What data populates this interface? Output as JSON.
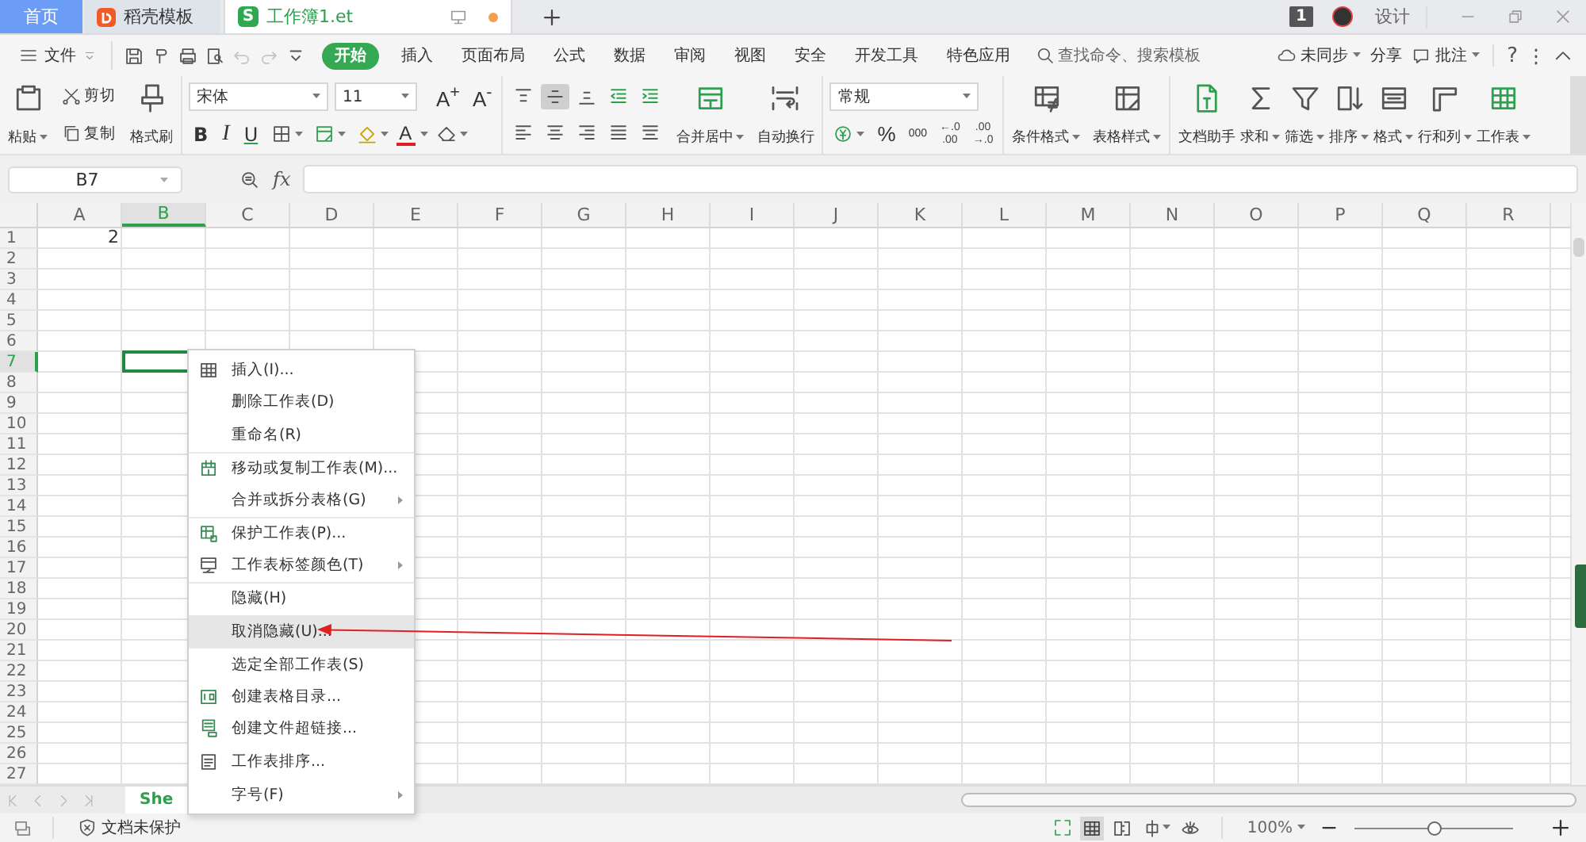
{
  "tabs": [
    {
      "label": "首页",
      "kind": "home",
      "selected": false
    },
    {
      "label": "稻壳模板",
      "kind": "docer",
      "selected": false
    },
    {
      "label": "工作簿1.et",
      "kind": "sheet",
      "logo": "S",
      "selected": true
    }
  ],
  "title_bar": {
    "badge": "1",
    "design": "设计"
  },
  "menu": {
    "file": "文件",
    "quick_tools": [
      {
        "kind": "save",
        "disabled": false
      },
      {
        "kind": "painter",
        "disabled": false
      },
      {
        "kind": "print",
        "disabled": false
      },
      {
        "kind": "preview",
        "disabled": false
      },
      {
        "kind": "undo",
        "disabled": true
      },
      {
        "kind": "redo",
        "disabled": true
      },
      {
        "kind": "more",
        "disabled": false
      }
    ],
    "items": [
      {
        "label": "开始",
        "selected": true
      },
      {
        "label": "插入",
        "selected": false
      },
      {
        "label": "页面布局",
        "selected": false
      },
      {
        "label": "公式",
        "selected": false
      },
      {
        "label": "数据",
        "selected": false
      },
      {
        "label": "审阅",
        "selected": false
      },
      {
        "label": "视图",
        "selected": false
      },
      {
        "label": "安全",
        "selected": false
      },
      {
        "label": "开发工具",
        "selected": false
      },
      {
        "label": "特色应用",
        "selected": false
      }
    ],
    "search": {
      "placeholder": "查找命令、搜索模板"
    },
    "sync": "未同步",
    "share": "分享",
    "comment": "批注",
    "help": "?"
  },
  "ribbon": {
    "clipboard": {
      "paste": "粘贴",
      "cut": "剪切",
      "copy": "复制",
      "painter": "格式刷"
    },
    "font": {
      "name": "宋体",
      "size": "11",
      "grow": "A$^{+}$",
      "shrink": "A$^{-}$",
      "color_button": "A",
      "styles": [
        {
          "label": "B",
          "kind": "bold"
        },
        {
          "label": "I",
          "kind": "italic"
        },
        {
          "label": "U",
          "kind": "underline"
        }
      ]
    },
    "alignment": [
      {
        "kind": "top",
        "selected": false
      },
      {
        "kind": "middle",
        "selected": true
      },
      {
        "kind": "bottom",
        "selected": false
      },
      {
        "kind": "outdent",
        "selected": false
      },
      {
        "kind": "indent",
        "selected": false
      },
      {
        "kind": "left",
        "selected": false
      },
      {
        "kind": "center",
        "selected": false
      },
      {
        "kind": "right",
        "selected": false
      },
      {
        "kind": "justify",
        "selected": false
      },
      {
        "kind": "distributed",
        "selected": false
      }
    ],
    "merge": "合并居中",
    "wrap": "自动换行",
    "number": {
      "format": "常规",
      "percent": "%",
      "thousands": "000",
      "decimals": [
        {
          "top": "←.0",
          "bottom": ".00"
        },
        {
          "top": ".00",
          "bottom": "→.0"
        }
      ]
    },
    "styles": [
      {
        "label": "条件格式",
        "kind": "condfmt"
      },
      {
        "label": "表格样式",
        "kind": "tablestyle"
      }
    ],
    "tools": [
      {
        "label": "文档助手",
        "kind": "doc",
        "dropdown": false
      },
      {
        "label": "求和",
        "kind": "sum",
        "dropdown": true
      },
      {
        "label": "筛选",
        "kind": "filter",
        "dropdown": true
      },
      {
        "label": "排序",
        "kind": "sort",
        "dropdown": true
      },
      {
        "label": "格式",
        "kind": "format",
        "dropdown": true
      },
      {
        "label": "行和列",
        "kind": "rowcol",
        "dropdown": true
      },
      {
        "label": "工作表",
        "kind": "sheet",
        "dropdown": true
      }
    ]
  },
  "formula_bar": {
    "name_box": "B7",
    "fx": "fx"
  },
  "sheet": {
    "columns": [
      {
        "label": "A",
        "selected": false
      },
      {
        "label": "B",
        "selected": true
      },
      {
        "label": "C",
        "selected": false
      },
      {
        "label": "D",
        "selected": false
      },
      {
        "label": "E",
        "selected": false
      },
      {
        "label": "F",
        "selected": false
      },
      {
        "label": "G",
        "selected": false
      },
      {
        "label": "H",
        "selected": false
      },
      {
        "label": "I",
        "selected": false
      },
      {
        "label": "J",
        "selected": false
      },
      {
        "label": "K",
        "selected": false
      },
      {
        "label": "L",
        "selected": false
      },
      {
        "label": "M",
        "selected": false
      },
      {
        "label": "N",
        "selected": false
      },
      {
        "label": "O",
        "selected": false
      },
      {
        "label": "P",
        "selected": false
      },
      {
        "label": "Q",
        "selected": false
      },
      {
        "label": "R",
        "selected": false
      }
    ],
    "rows": [
      {
        "label": "1",
        "selected": false,
        "cells": [
          "2"
        ]
      },
      {
        "label": "2",
        "selected": false
      },
      {
        "label": "3",
        "selected": false
      },
      {
        "label": "4",
        "selected": false
      },
      {
        "label": "5",
        "selected": false
      },
      {
        "label": "6",
        "selected": false
      },
      {
        "label": "7",
        "selected": true
      },
      {
        "label": "8",
        "selected": false
      },
      {
        "label": "9",
        "selected": false
      },
      {
        "label": "10",
        "selected": false
      },
      {
        "label": "11",
        "selected": false
      },
      {
        "label": "12",
        "selected": false
      },
      {
        "label": "13",
        "selected": false
      },
      {
        "label": "14",
        "selected": false
      },
      {
        "label": "15",
        "selected": false
      },
      {
        "label": "16",
        "selected": false
      },
      {
        "label": "17",
        "selected": false
      },
      {
        "label": "18",
        "selected": false
      },
      {
        "label": "19",
        "selected": false
      },
      {
        "label": "20",
        "selected": false
      },
      {
        "label": "21",
        "selected": false
      },
      {
        "label": "22",
        "selected": false
      },
      {
        "label": "23",
        "selected": false
      },
      {
        "label": "24",
        "selected": false
      },
      {
        "label": "25",
        "selected": false
      },
      {
        "label": "26",
        "selected": false
      },
      {
        "label": "27",
        "selected": false
      }
    ]
  },
  "context_menu": [
    {
      "label": "插入(I)...",
      "kind": "table",
      "submenu": false,
      "group_start": false,
      "selected": false
    },
    {
      "label": "删除工作表(D)",
      "kind": "plain",
      "submenu": false,
      "group_start": false,
      "selected": false
    },
    {
      "label": "重命名(R)",
      "kind": "plain",
      "submenu": false,
      "group_start": false,
      "selected": false
    },
    {
      "label": "移动或复制工作表(M)...",
      "kind": "move",
      "submenu": false,
      "group_start": true,
      "selected": false
    },
    {
      "label": "合并或拆分表格(G)",
      "kind": "plain",
      "submenu": true,
      "group_start": false,
      "selected": false
    },
    {
      "label": "保护工作表(P)...",
      "kind": "protect",
      "submenu": false,
      "group_start": true,
      "selected": false
    },
    {
      "label": "工作表标签颜色(T)",
      "kind": "tabcolor",
      "submenu": true,
      "group_start": false,
      "selected": false
    },
    {
      "label": "隐藏(H)",
      "kind": "plain",
      "submenu": false,
      "group_start": true,
      "selected": false
    },
    {
      "label": "取消隐藏(U)...",
      "kind": "plain",
      "submenu": false,
      "group_start": false,
      "selected": true
    },
    {
      "label": "选定全部工作表(S)",
      "kind": "plain",
      "submenu": false,
      "group_start": true,
      "selected": false
    },
    {
      "label": "创建表格目录...",
      "kind": "toc",
      "submenu": false,
      "group_start": false,
      "selected": false
    },
    {
      "label": "创建文件超链接...",
      "kind": "link",
      "submenu": false,
      "group_start": false,
      "selected": false
    },
    {
      "label": "工作表排序...",
      "kind": "sortlist",
      "submenu": false,
      "group_start": false,
      "selected": false
    },
    {
      "label": "字号(F)",
      "kind": "plain",
      "submenu": true,
      "group_start": false,
      "selected": false
    }
  ],
  "sheet_tabs": [
    {
      "label": "She",
      "selected": true
    }
  ],
  "status_bar": {
    "protection": "文档未保护",
    "zoom": "100%",
    "zoom_slider": {
      "level": 0.5
    }
  }
}
